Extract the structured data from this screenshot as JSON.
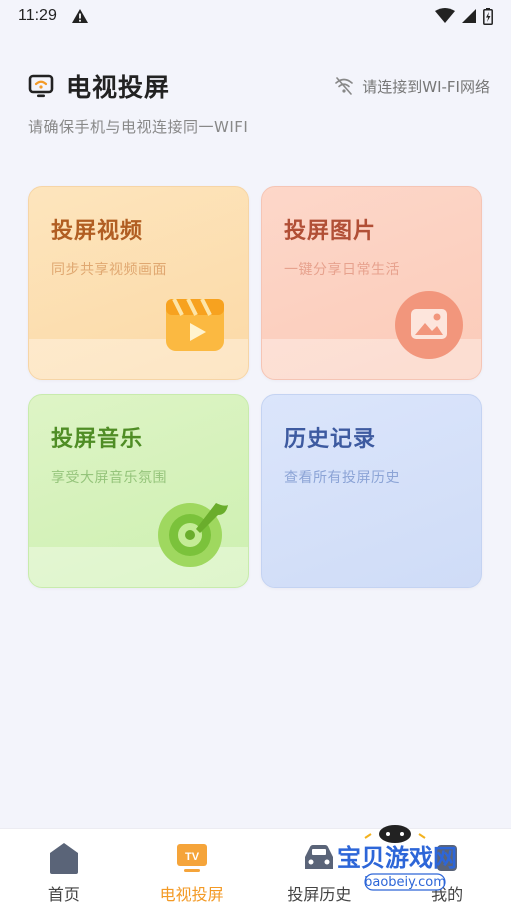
{
  "status_bar": {
    "time": "11:29"
  },
  "header": {
    "title": "电视投屏",
    "wifi_status": "请连接到WI-FI网络",
    "subtitle": "请确保手机与电视连接同一WIFI"
  },
  "cards": [
    {
      "id": "video",
      "title": "投屏视频",
      "desc": "同步共享视频画面",
      "icon": "film-play-icon",
      "color": "#b15e22"
    },
    {
      "id": "image",
      "title": "投屏图片",
      "desc": "一键分享日常生活",
      "icon": "picture-icon",
      "color": "#b14f36"
    },
    {
      "id": "music",
      "title": "投屏音乐",
      "desc": "享受大屏音乐氛围",
      "icon": "music-disc-icon",
      "color": "#4f8d25"
    },
    {
      "id": "history",
      "title": "历史记录",
      "desc": "查看所有投屏历史",
      "icon": "",
      "color": "#3d5aa0"
    }
  ],
  "bottom_nav": [
    {
      "label": "首页",
      "icon": "home-icon",
      "active": false
    },
    {
      "label": "电视投屏",
      "icon": "tv-icon",
      "active": true,
      "icon_text": "TV"
    },
    {
      "label": "投屏历史",
      "icon": "car-icon",
      "active": false
    },
    {
      "label": "我的",
      "icon": "profile-icon",
      "active": false
    }
  ],
  "watermark": {
    "text": "宝贝游戏网",
    "url": "baobeiy.com"
  },
  "colors": {
    "accent": "#f39a26",
    "background": "#f3f4fb"
  }
}
